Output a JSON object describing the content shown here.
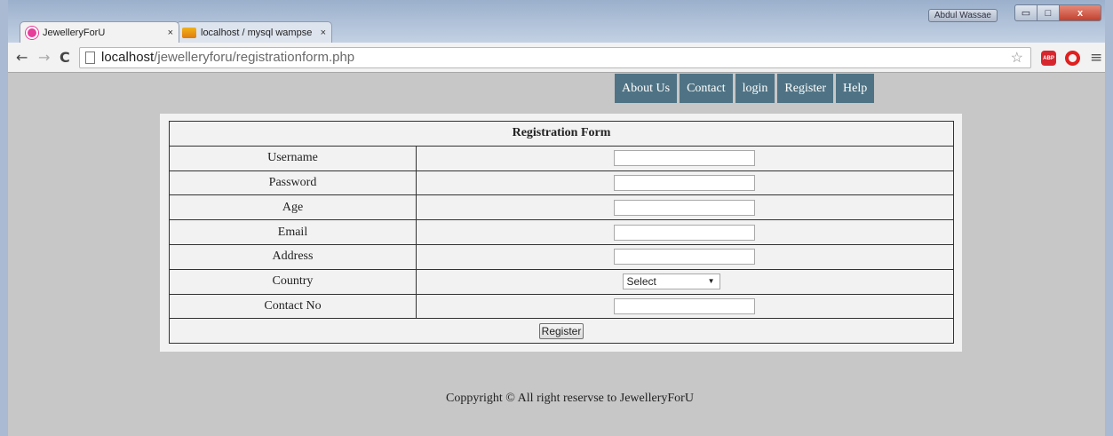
{
  "browser": {
    "tabs": [
      {
        "label": "JewelleryForU",
        "close": "×"
      },
      {
        "label": "localhost / mysql wampse",
        "close": "×"
      }
    ],
    "window_user": "Abdul Wassae",
    "window_controls": {
      "minimize": "▭",
      "maximize": "□",
      "close": "x"
    },
    "url_host": "localhost",
    "url_path": "/jewelleryforu/registrationform.php",
    "abp_label": "ABP"
  },
  "site_nav": [
    "About Us",
    "Contact",
    "login",
    "Register",
    "Help"
  ],
  "form": {
    "title": "Registration Form",
    "fields": [
      {
        "label": "Username",
        "type": "text",
        "value": ""
      },
      {
        "label": "Password",
        "type": "password",
        "value": ""
      },
      {
        "label": "Age",
        "type": "text",
        "value": ""
      },
      {
        "label": "Email",
        "type": "text",
        "value": ""
      },
      {
        "label": "Address",
        "type": "text",
        "value": ""
      },
      {
        "label": "Country",
        "type": "select",
        "value": "Select"
      },
      {
        "label": "Contact No",
        "type": "text",
        "value": ""
      }
    ],
    "submit_label": "Register"
  },
  "footer": "Coppyright © All right reservse to JewelleryForU"
}
